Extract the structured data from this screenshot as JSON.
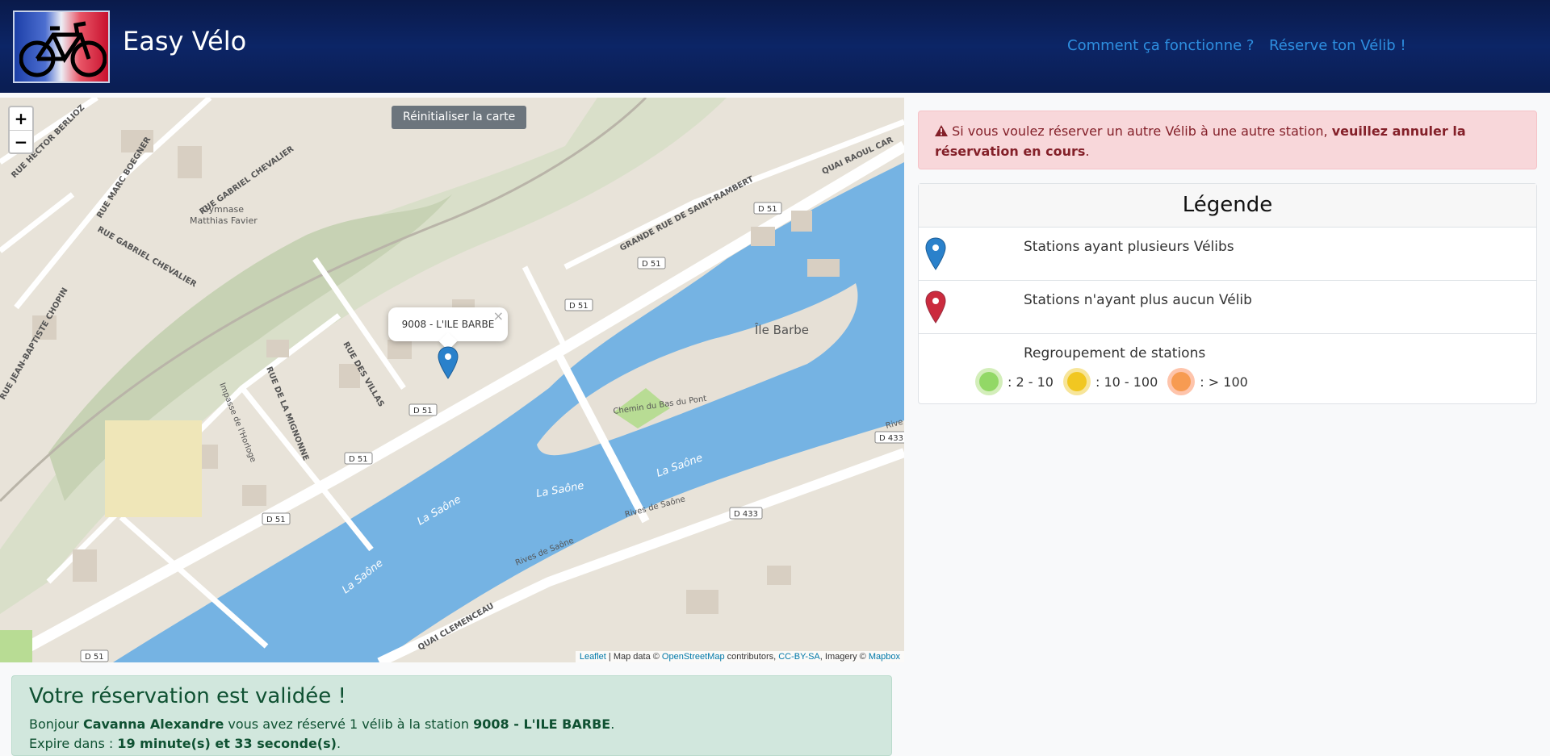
{
  "header": {
    "brand": "Easy Vélo",
    "nav": [
      "Comment ça fonctionne ?",
      "Réserve ton Vélib !"
    ]
  },
  "map": {
    "zoom_in": "+",
    "zoom_out": "−",
    "reset_label": "Réinitialiser la carte",
    "popup_text": "9008 - L'ILE BARBE",
    "popup_close": "×",
    "streets": [
      "RUE HECTOR BERLIOZ",
      "RUE MARC BOEGNER",
      "RUE GABRIEL CHEVALIER",
      "RUE GABRIEL CHEVALIER",
      "GRANDE RUE DE SAINT-RAMBERT",
      "QUAI RAOUL CAR",
      "RUE JEAN-BAPTISTE CHOPIN",
      "RUE DES VILLAS",
      "RUE DE LA MIGNONNE",
      "Impasse de l'Horloge",
      "Chemin du Bas du Pont",
      "QUAI CLEMENCEAU",
      "Rives de Saône",
      "Rives de Saône",
      "Rive"
    ],
    "places": [
      "Gymnase",
      "Matthias Favier",
      "Île Barbe"
    ],
    "river_labels": [
      "La Saône",
      "La Saône",
      "La Saône",
      "La Saône"
    ],
    "road_badges": [
      "D 51",
      "D 51",
      "D 51",
      "D 51",
      "D 51",
      "D 51",
      "D 51",
      "D 433",
      "D 433"
    ],
    "attribution": {
      "leaflet": "Leaflet",
      "sep1": " | Map data © ",
      "osm": "OpenStreetMap",
      "sep2": " contributors, ",
      "license": "CC-BY-SA",
      "sep3": ", Imagery © ",
      "mapbox": "Mapbox"
    }
  },
  "alert": {
    "icon": "warning-icon",
    "text": " Si vous voulez réserver un autre Vélib à une autre station, ",
    "bold": "veuillez annuler la réservation en cours",
    "end": "."
  },
  "legend": {
    "title": "Légende",
    "row1": "Stations ayant plusieurs Vélibs",
    "row2": "Stations n'ayant plus aucun Vélib",
    "row3": "Regroupement de stations",
    "clusters": [
      ": 2 - 10",
      ": 10 - 100",
      ": > 100"
    ]
  },
  "reservation": {
    "title": "Votre réservation est validée !",
    "l1a": "Bonjour ",
    "name": "Cavanna Alexandre",
    "l1b": " vous avez réservé 1 vélib à la station ",
    "station": "9008 - L'ILE BARBE",
    "l1c": ".",
    "l2a": "Expire dans : ",
    "timer": "19 minute(s) et 33 seconde(s)",
    "l2b": "."
  },
  "colors": {
    "header_bg": "#0c2566",
    "nav_link": "#2e8fe0",
    "river": "#75b3e3",
    "marker_blue": "#2a81cb",
    "marker_red": "#cb2b3e"
  }
}
